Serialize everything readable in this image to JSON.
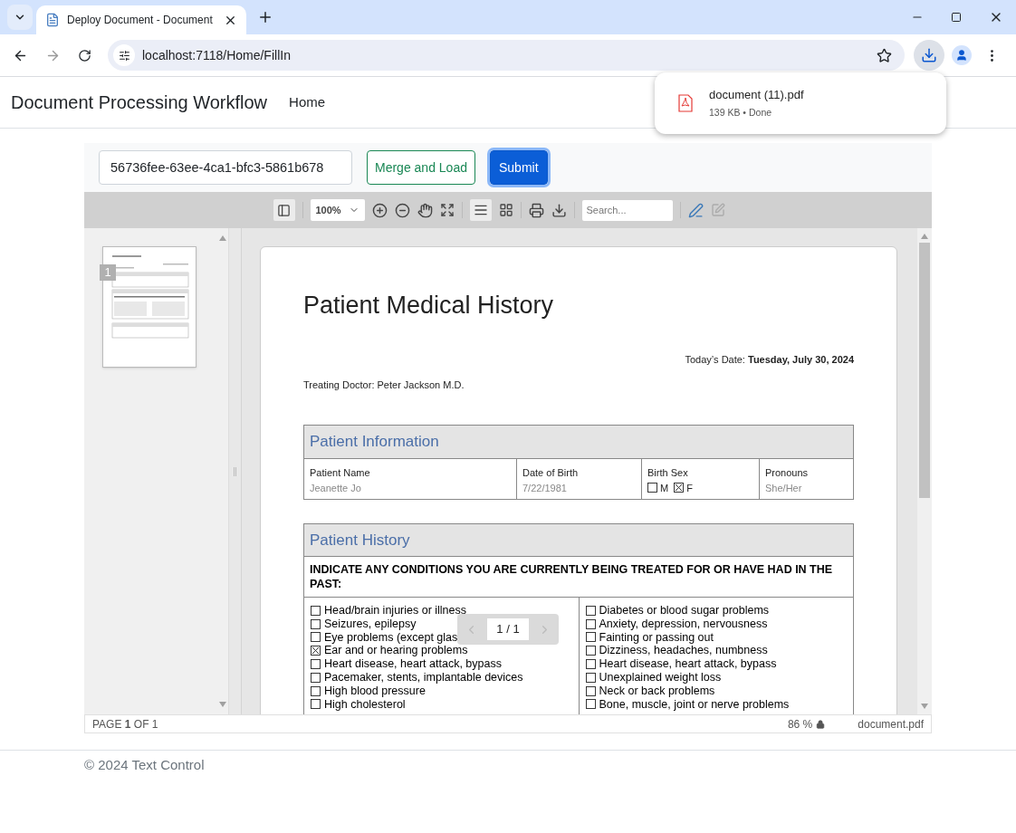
{
  "browser": {
    "tab_title": "Deploy Document - Document",
    "url": "localhost:7118/Home/FillIn"
  },
  "downloads_popup": {
    "file_name": "document (11).pdf",
    "status": "139 KB • Done"
  },
  "navbar": {
    "brand": "Document Processing Workflow",
    "links": [
      "Home"
    ]
  },
  "form": {
    "document_id": "56736fee-63ee-4ca1-bfc3-5861b678",
    "buttons": [
      {
        "label": "Merge and Load",
        "kind": "outline"
      },
      {
        "label": "Submit",
        "kind": "primary"
      }
    ]
  },
  "viewer_toolbar": {
    "zoom": "100%",
    "search_placeholder": "Search..."
  },
  "thumbnail": {
    "page_number": "1"
  },
  "document": {
    "title": "Patient Medical History",
    "date": "Today’s Date: **Tuesday, July 30, 2024**",
    "doctor": "Treating Doctor: Peter Jackson M.D.",
    "patient_information": {
      "heading": "Patient Information",
      "fields": [
        {
          "kind": "text",
          "label": "Patient Name",
          "value": "Jeanette Jo"
        },
        {
          "kind": "text",
          "label": "Date of Birth",
          "value": "7/22/1981"
        },
        {
          "kind": "options",
          "label": "Birth Sex",
          "options": [
            {
              "label": "M",
              "checked": false
            },
            {
              "label": "F",
              "checked": true
            }
          ]
        },
        {
          "kind": "text",
          "label": "Pronouns",
          "value": "She/Her"
        }
      ]
    },
    "patient_history": {
      "heading": "Patient History",
      "instruction": "INDICATE ANY CONDITIONS YOU ARE CURRENTLY BEING TREATED FOR OR HAVE HAD IN THE PAST:",
      "columns": [
        [
          {
            "label": "Head/brain injuries or illness",
            "checked": false
          },
          {
            "label": "Seizures, epilepsy",
            "checked": false
          },
          {
            "label": "Eye problems (except glas",
            "checked": false
          },
          {
            "label": "Ear and or hearing problems",
            "checked": true
          },
          {
            "label": "Heart disease, heart attack, bypass",
            "checked": false
          },
          {
            "label": "Pacemaker, stents, implantable devices",
            "checked": false
          },
          {
            "label": "High blood pressure",
            "checked": false
          },
          {
            "label": "High cholesterol",
            "checked": false
          }
        ],
        [
          {
            "label": "Diabetes or blood sugar problems",
            "checked": false
          },
          {
            "label": "Anxiety, depression, nervousness",
            "checked": false
          },
          {
            "label": "Fainting or passing out",
            "checked": false
          },
          {
            "label": "Dizziness, headaches, numbness",
            "checked": false
          },
          {
            "label": "Heart disease, heart attack, bypass",
            "checked": false
          },
          {
            "label": "Unexplained weight loss",
            "checked": false
          },
          {
            "label": "Neck or back problems",
            "checked": false
          },
          {
            "label": "Bone, muscle, joint or nerve problems",
            "checked": false
          }
        ]
      ]
    }
  },
  "page_nav": "1 / 1",
  "status_bar": {
    "page": "PAGE **1** OF 1",
    "zoom": "86 %",
    "file_name": "document.pdf"
  },
  "footer": "© 2024 Text Control"
}
